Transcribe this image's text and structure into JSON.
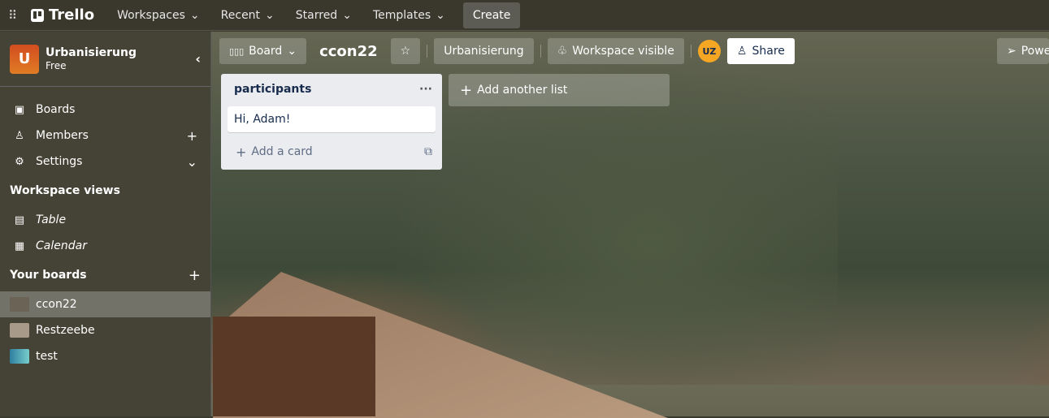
{
  "topbar": {
    "brand": "Trello",
    "nav": [
      "Workspaces",
      "Recent",
      "Starred",
      "Templates"
    ],
    "create": "Create"
  },
  "sidebar": {
    "workspace_initial": "U",
    "workspace_name": "Urbanisierung",
    "plan": "Free",
    "items": [
      {
        "label": "Boards",
        "icon": "board-icon"
      },
      {
        "label": "Members",
        "icon": "person-icon"
      },
      {
        "label": "Settings",
        "icon": "gear-icon"
      }
    ],
    "views_heading": "Workspace views",
    "views": [
      {
        "label": "Table",
        "icon": "table-icon"
      },
      {
        "label": "Calendar",
        "icon": "calendar-icon"
      }
    ],
    "boards_heading": "Your boards",
    "boards": [
      {
        "label": "ccon22",
        "color": "#6b6356"
      },
      {
        "label": "Restzeebe",
        "color": "#a89a88"
      },
      {
        "label": "test",
        "color": "#2f7fa0"
      }
    ]
  },
  "header": {
    "view": "Board",
    "title": "ccon22",
    "workspace": "Urbanisierung",
    "visibility": "Workspace visible",
    "avatar": "UZ",
    "share": "Share",
    "powerups": "Power-Ups"
  },
  "list": {
    "title": "participants",
    "cards": [
      "Hi, Adam!"
    ],
    "add_card": "Add a card"
  },
  "add_list": "Add another list"
}
